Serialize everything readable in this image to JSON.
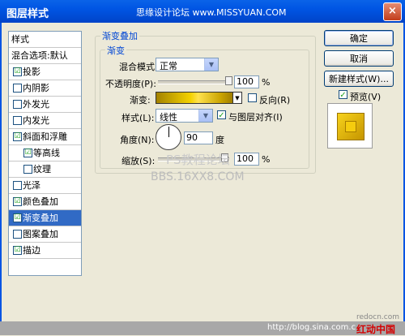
{
  "window": {
    "title": "图层样式",
    "watermark_top": "思缘设计论坛 www.MISSYUAN.COM",
    "close_glyph": "×"
  },
  "sidebar": {
    "header": "样式",
    "blend_options": "混合选项:默认",
    "items": [
      {
        "label": "投影",
        "checked": true,
        "check": "☑"
      },
      {
        "label": "内阴影",
        "checked": false,
        "check": ""
      },
      {
        "label": "外发光",
        "checked": false,
        "check": ""
      },
      {
        "label": "内发光",
        "checked": false,
        "check": ""
      },
      {
        "label": "斜面和浮雕",
        "checked": true,
        "check": "☑"
      },
      {
        "label": "等高线",
        "checked": true,
        "check": "☑"
      },
      {
        "label": "纹理",
        "checked": false,
        "check": ""
      },
      {
        "label": "光泽",
        "checked": false,
        "check": ""
      },
      {
        "label": "颜色叠加",
        "checked": true,
        "check": "☑"
      },
      {
        "label": "渐变叠加",
        "checked": true,
        "check": "☑"
      },
      {
        "label": "图案叠加",
        "checked": false,
        "check": ""
      },
      {
        "label": "描边",
        "checked": true,
        "check": "☑"
      }
    ]
  },
  "panel": {
    "group_title": "渐变叠加",
    "subgroup_title": "渐变",
    "blend_mode_label": "混合模式:",
    "blend_mode_value": "正常",
    "opacity_label": "不透明度(P):",
    "opacity_value": "100",
    "opacity_unit": "%",
    "gradient_label": "渐变:",
    "reverse_label": "反向(R)",
    "reverse_checked": false,
    "style_label": "样式(L):",
    "style_value": "线性",
    "align_label": "与图层对齐(I)",
    "align_checked": true,
    "align_check": "✓",
    "angle_label": "角度(N):",
    "angle_value": "90",
    "angle_unit": "度",
    "scale_label": "缩放(S):",
    "scale_value": "100",
    "scale_unit": "%"
  },
  "buttons": {
    "ok": "确定",
    "cancel": "取消",
    "new_style": "新建样式(W)...",
    "preview_label": "预览(V)",
    "preview_checked": true,
    "preview_check": "✓"
  },
  "watermarks": {
    "ps_text": "PS教程论坛",
    "bbs_text": "BBS.16XX8.COM",
    "blog_text": "http://blog.sina.com.c",
    "red_text": "红动中国",
    "redocn": "redocn.com"
  },
  "colors": {
    "titlebar": "#0054e3",
    "selected": "#316ac5",
    "gold": "#f4d200"
  }
}
